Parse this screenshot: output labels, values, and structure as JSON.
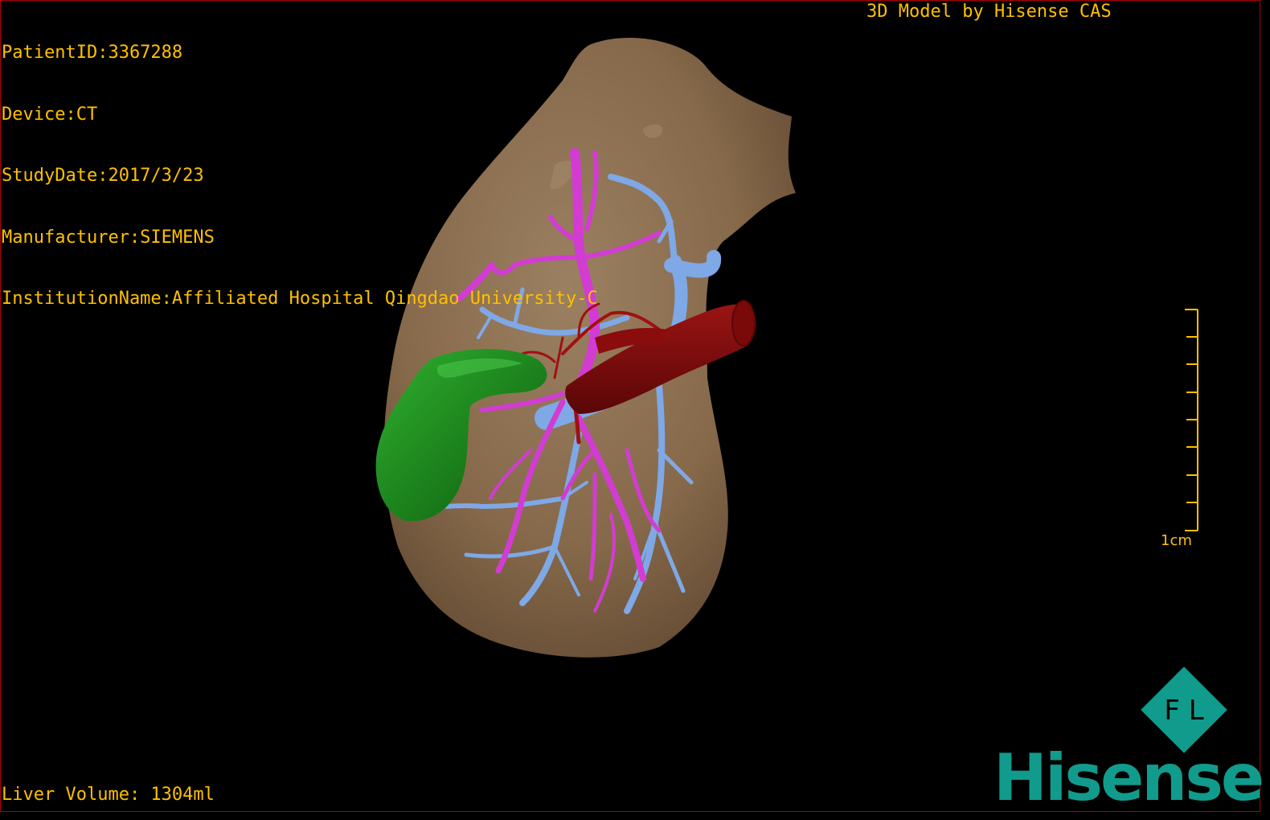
{
  "overlay": {
    "patient_id": "PatientID:3367288",
    "device": "Device:CT",
    "study_date": "StudyDate:2017/3/23",
    "manufacturer": "Manufacturer:SIEMENS",
    "institution": "InstitutionName:Affiliated Hospital Qingdao University-C",
    "model_credit": "3D Model by Hisense CAS",
    "liver_volume": "Liver Volume: 1304ml"
  },
  "scale_bar": {
    "label": "1cm"
  },
  "logo": {
    "brand": "Hisense",
    "mark_letters": "F L"
  },
  "colors": {
    "text": "#ffc000",
    "liver": "#8a6e4e",
    "portal_vein": "#7fa8e6",
    "hepatic_vein": "#d23cd2",
    "artery": "#a01010",
    "ivc": "#7a0a0a",
    "gallbladder": "#1a8a1a",
    "brand": "#119b8c"
  }
}
